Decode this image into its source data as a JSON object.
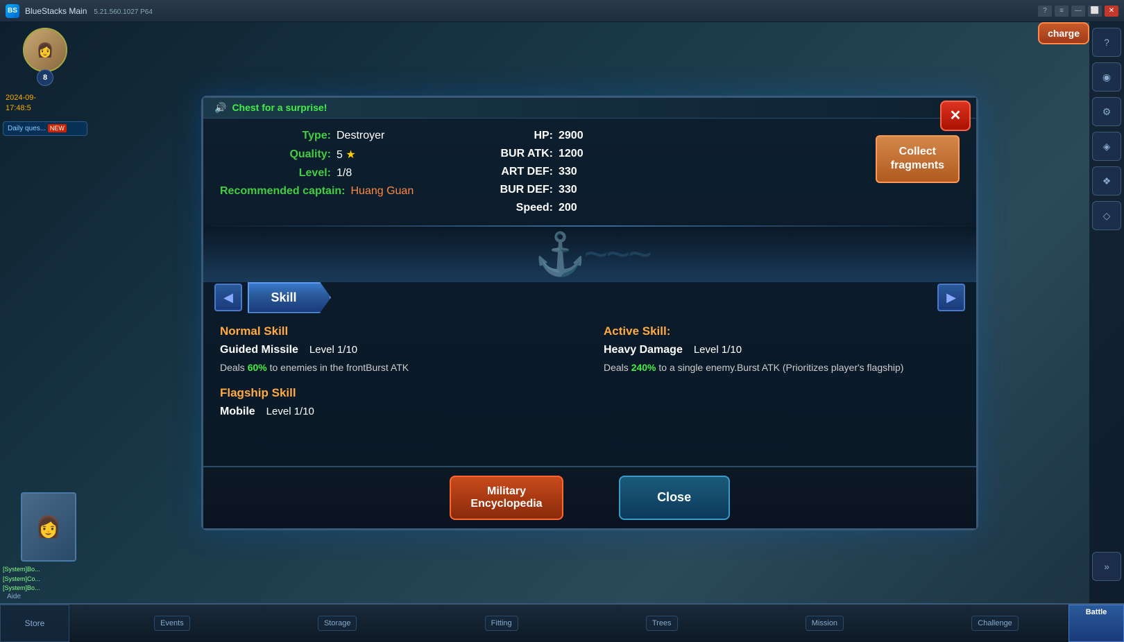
{
  "titlebar": {
    "title": "BlueStacks Main",
    "subtitle": "5.21.560.1027  P64",
    "icon": "BS"
  },
  "notification": {
    "icon": "🔊",
    "text": "Chest for a surprise!"
  },
  "ship": {
    "type_label": "Type:",
    "type_value": "Destroyer",
    "quality_label": "Quality:",
    "quality_value": "5",
    "level_label": "Level:",
    "level_value": "1/8",
    "captain_label": "Recommended captain:",
    "captain_value": "Huang Guan",
    "hp_label": "HP:",
    "hp_value": "2900",
    "bur_atk_label": "BUR ATK:",
    "bur_atk_value": "1200",
    "art_def_label": "ART DEF:",
    "art_def_value": "330",
    "bur_def_label": "BUR DEF:",
    "bur_def_value": "330",
    "speed_label": "Speed:",
    "speed_value": "200"
  },
  "collect_btn": "Collect\nfragments",
  "tabs": {
    "active": "Skill"
  },
  "skills": {
    "normal_skill_title": "Normal Skill",
    "normal_skill_name": "Guided Missile",
    "normal_skill_level": "Level 1/10",
    "normal_skill_desc_before": "Deals ",
    "normal_skill_highlight": "60%",
    "normal_skill_desc_after": " to enemies in the frontBurst ATK",
    "active_skill_title": "Active Skill:",
    "active_skill_name": "Heavy Damage",
    "active_skill_level": "Level 1/10",
    "active_skill_desc_before": "Deals ",
    "active_skill_highlight": "240%",
    "active_skill_desc_after": " to a single enemy.Burst ATK (Prioritizes player's flagship)",
    "flagship_skill_title": "Flagship Skill",
    "flagship_skill_name": "Mobile",
    "flagship_skill_level": "Level 1/10"
  },
  "footer": {
    "encyclopedia_label": "Military\nEncyclopedia",
    "close_label": "Close"
  },
  "bottom_bar": {
    "store": "Store",
    "events": "Events",
    "storage": "Storage",
    "fitting": "Fitting",
    "trees": "Trees",
    "mission": "Mission",
    "challenge": "Challenge",
    "battle": "Battle"
  },
  "right_sidebar": {
    "charge": "charge",
    "icons": [
      "?",
      "≡",
      "◉",
      "⚙",
      "◈",
      "❖",
      "◇"
    ]
  },
  "player": {
    "level": "8",
    "date": "2024-09-",
    "time": "17:48:5"
  },
  "chat": {
    "lines": [
      "[System]Bo...",
      "[System]Co...",
      "[System]Bo..."
    ]
  },
  "aide_label": "Aide"
}
